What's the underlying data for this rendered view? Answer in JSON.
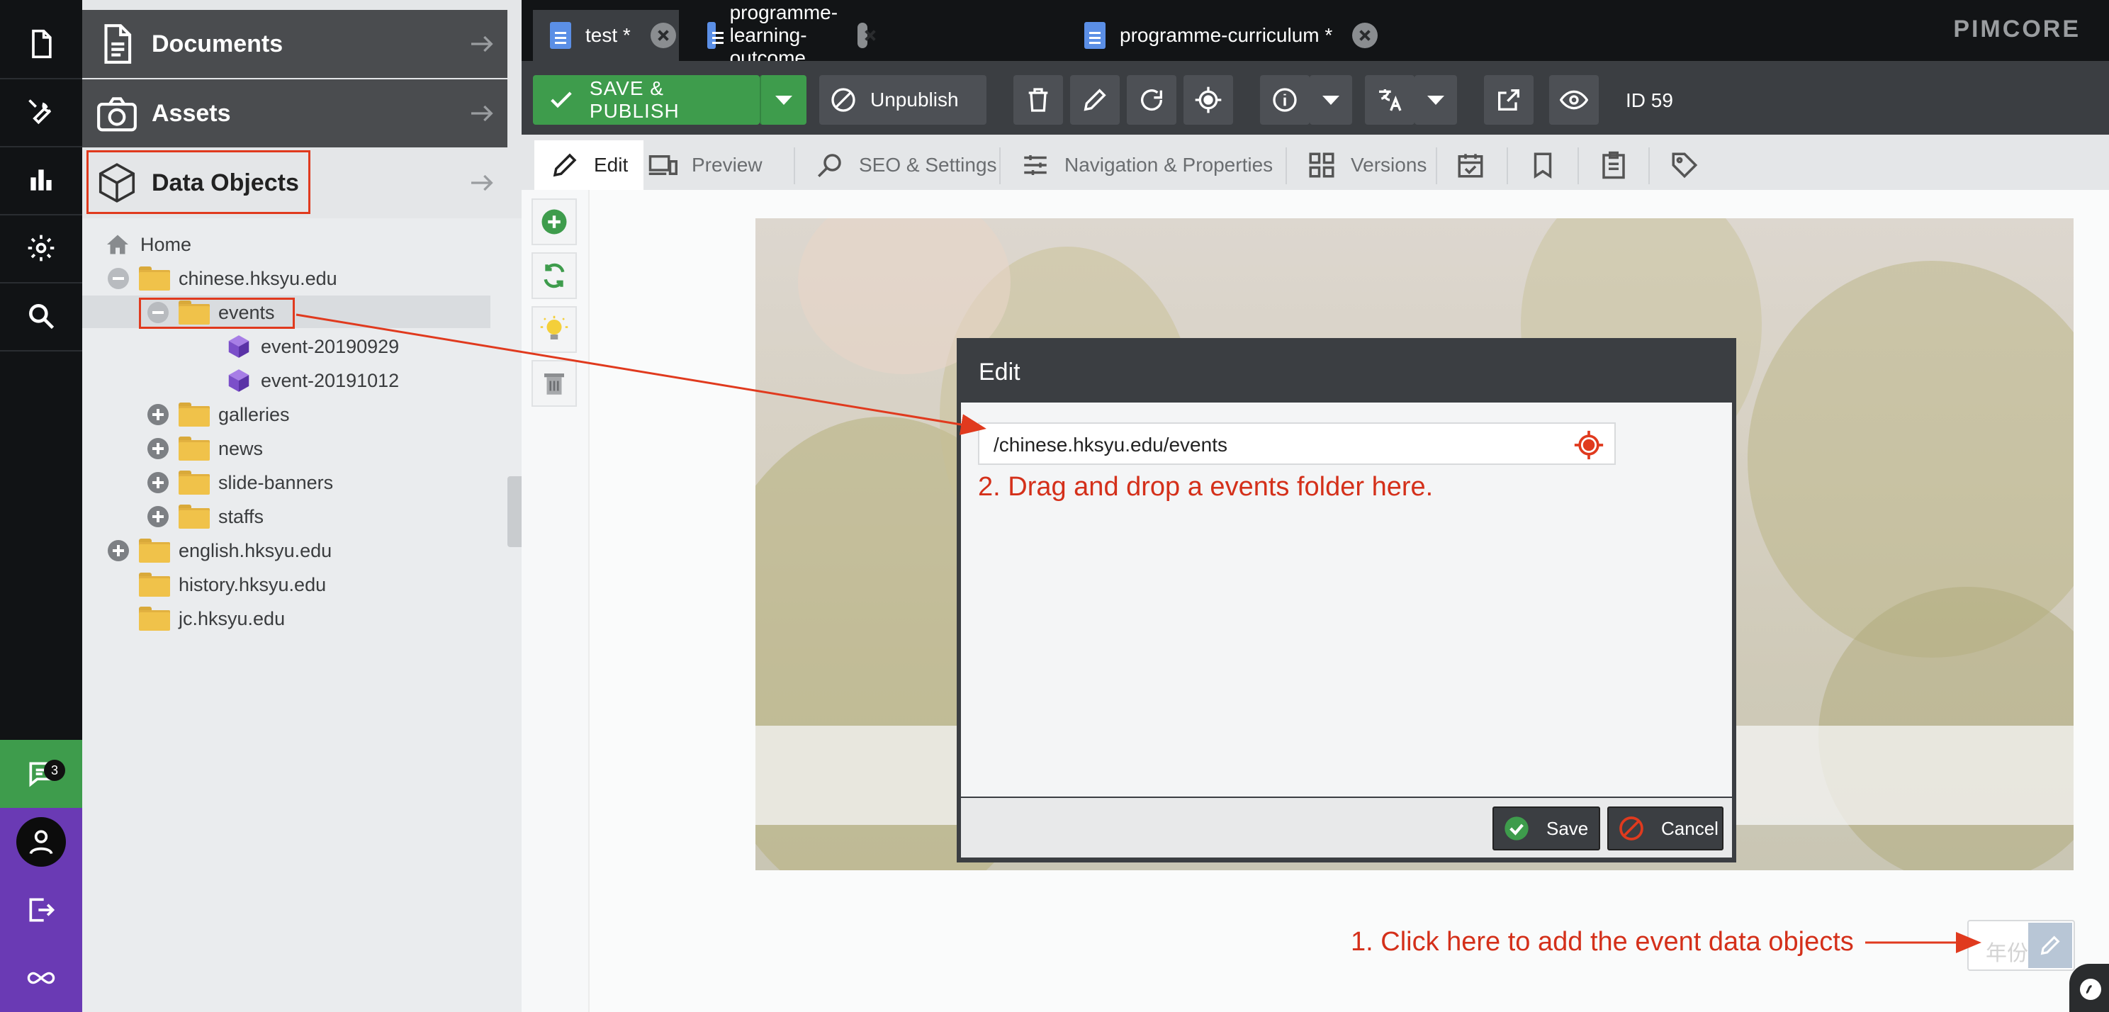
{
  "iconbar": {
    "items": [
      "documents-nav",
      "tools-nav",
      "analytics-nav",
      "settings-nav",
      "search-nav"
    ],
    "chat_badge": "3"
  },
  "tree": {
    "accordion": {
      "documents": "Documents",
      "assets": "Assets",
      "data_objects": "Data Objects"
    },
    "nodes": {
      "home": "Home",
      "chinese": "chinese.hksyu.edu",
      "events": "events",
      "event1": "event-20190929",
      "event2": "event-20191012",
      "galleries": "galleries",
      "news": "news",
      "slide_banners": "slide-banners",
      "staffs": "staffs",
      "english": "english.hksyu.edu",
      "history": "history.hksyu.edu",
      "jc": "jc.hksyu.edu"
    }
  },
  "tabs": [
    {
      "label": "test *"
    },
    {
      "label": "programme-learning-outcome"
    },
    {
      "label": "programme-curriculum *"
    }
  ],
  "brand": "PIMCORE",
  "toolbar": {
    "save_publish": "SAVE & PUBLISH",
    "unpublish": "Unpublish",
    "id_label": "ID 59"
  },
  "subtabs": {
    "edit": "Edit",
    "preview": "Preview",
    "seo": "SEO & Settings",
    "navigation": "Navigation & Properties",
    "versions": "Versions"
  },
  "modal": {
    "title": "Edit",
    "field_value": "/chinese.hksyu.edu/events",
    "save": "Save",
    "cancel": "Cancel"
  },
  "field": {
    "placeholder": "年份"
  },
  "annotations": {
    "step1": "1. Click here to add the event data objects",
    "step2": "2. Drag and drop a events folder here."
  },
  "colors": {
    "accent_green": "#3e9c4c",
    "annotation_red": "#d4301a",
    "purple": "#6a3ab4",
    "dark_bar": "#3b3e42"
  }
}
